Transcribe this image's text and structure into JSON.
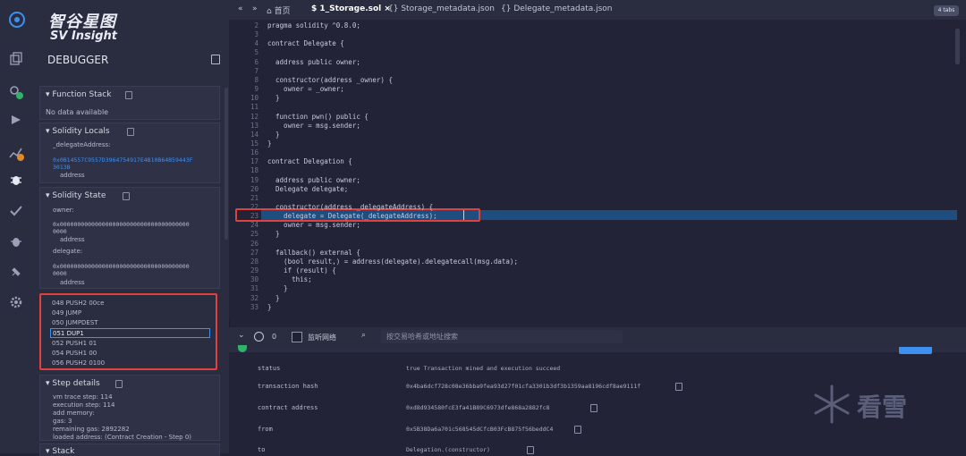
{
  "brand": {
    "name_cn": "智谷星图",
    "name_en": "SV Insight"
  },
  "panel": {
    "title": "DEBUGGER",
    "function_stack": {
      "title": "Function Stack",
      "empty": "No data available"
    },
    "solidity_locals": {
      "title": "Solidity Locals",
      "var_name": "_delegateAddress:",
      "var_value_1": "0x0B14557C9557D3964754917E4B10B64B59443F",
      "var_value_2": "3013B",
      "var_type": "address"
    },
    "solidity_state": {
      "title": "Solidity State",
      "owner_label": "owner:",
      "owner_value_1": "0x0000000000000000000000000000000000000",
      "owner_value_2": "0000",
      "owner_type": "address",
      "delegate_label": "delegate:",
      "delegate_value_1": "0x0000000000000000000000000000000000000",
      "delegate_value_2": "0000",
      "delegate_type": "address"
    },
    "opcodes": [
      "048 PUSH2 00ce",
      "049 JUMP",
      "050 JUMPDEST",
      "051 DUP1",
      "052 PUSH1 01",
      "054 PUSH1 00",
      "056 PUSH2 0100"
    ],
    "step_details": {
      "title": "Step details",
      "vm_trace": "vm trace step: 114",
      "exec_step": "execution step: 114",
      "add_memory": "add memory:",
      "gas": "gas:      3",
      "remaining_gas": "remaining gas: 2892282",
      "loaded_address": "loaded address: (Contract Creation - Step 0)"
    },
    "stack_title": "Stack"
  },
  "tabs": {
    "home": "首页",
    "storage_sol": "1_Storage.sol",
    "storage_meta": "Storage_metadata.json",
    "delegate_meta": "Delegate_metadata.json",
    "indent": "4 tabs"
  },
  "code": {
    "lines": [
      {
        "n": "2",
        "t": "pragma solidity ^0.8.0;"
      },
      {
        "n": "3",
        "t": ""
      },
      {
        "n": "4",
        "t": "contract Delegate {"
      },
      {
        "n": "5",
        "t": ""
      },
      {
        "n": "6",
        "t": "  address public owner;"
      },
      {
        "n": "7",
        "t": ""
      },
      {
        "n": "8",
        "t": "  constructor(address _owner) {"
      },
      {
        "n": "9",
        "t": "    owner = _owner;"
      },
      {
        "n": "10",
        "t": "  }"
      },
      {
        "n": "11",
        "t": ""
      },
      {
        "n": "12",
        "t": "  function pwn() public {"
      },
      {
        "n": "13",
        "t": "    owner = msg.sender;"
      },
      {
        "n": "14",
        "t": "  }"
      },
      {
        "n": "15",
        "t": "}"
      },
      {
        "n": "16",
        "t": ""
      },
      {
        "n": "17",
        "t": "contract Delegation {"
      },
      {
        "n": "18",
        "t": ""
      },
      {
        "n": "19",
        "t": "  address public owner;"
      },
      {
        "n": "20",
        "t": "  Delegate delegate;"
      },
      {
        "n": "21",
        "t": ""
      },
      {
        "n": "22",
        "t": "  constructor(address _delegateAddress) {"
      },
      {
        "n": "23",
        "t": "    delegate = Delegate(_delegateAddress);"
      },
      {
        "n": "24",
        "t": "    owner = msg.sender;"
      },
      {
        "n": "25",
        "t": "  }"
      },
      {
        "n": "26",
        "t": ""
      },
      {
        "n": "27",
        "t": "  fallback() external {"
      },
      {
        "n": "28",
        "t": "    (bool result,) = address(delegate).delegatecall(msg.data);"
      },
      {
        "n": "29",
        "t": "    if (result) {"
      },
      {
        "n": "30",
        "t": "      this;"
      },
      {
        "n": "31",
        "t": "    }"
      },
      {
        "n": "32",
        "t": "  }"
      },
      {
        "n": "33",
        "t": "}"
      }
    ]
  },
  "terminal": {
    "count": "0",
    "listen_label": "监听网络",
    "search_placeholder": "按交易哈希或地址搜索",
    "rows": [
      {
        "k": "status",
        "v": "true Transaction mined and execution succeed"
      },
      {
        "k": "transaction hash",
        "v": "0x4ba6dcf728c08e36bba9fea93d27f01cfa3301b3df3b1359aa8196cdf8ae9111f"
      },
      {
        "k": "contract address",
        "v": "0xd8d934580fcE3fa41B89C6973dfe868a2882fc8"
      },
      {
        "k": "from",
        "v": "0x5B38Da6a701c568545dCfcB03FcB875f56beddC4"
      },
      {
        "k": "to",
        "v": "Delegation.(constructor)"
      }
    ]
  },
  "watermark": {
    "text": "看雪"
  },
  "colors": {
    "accent": "#3d8ff0",
    "highlight": "#1e4e80",
    "red_box": "#e0413d"
  }
}
